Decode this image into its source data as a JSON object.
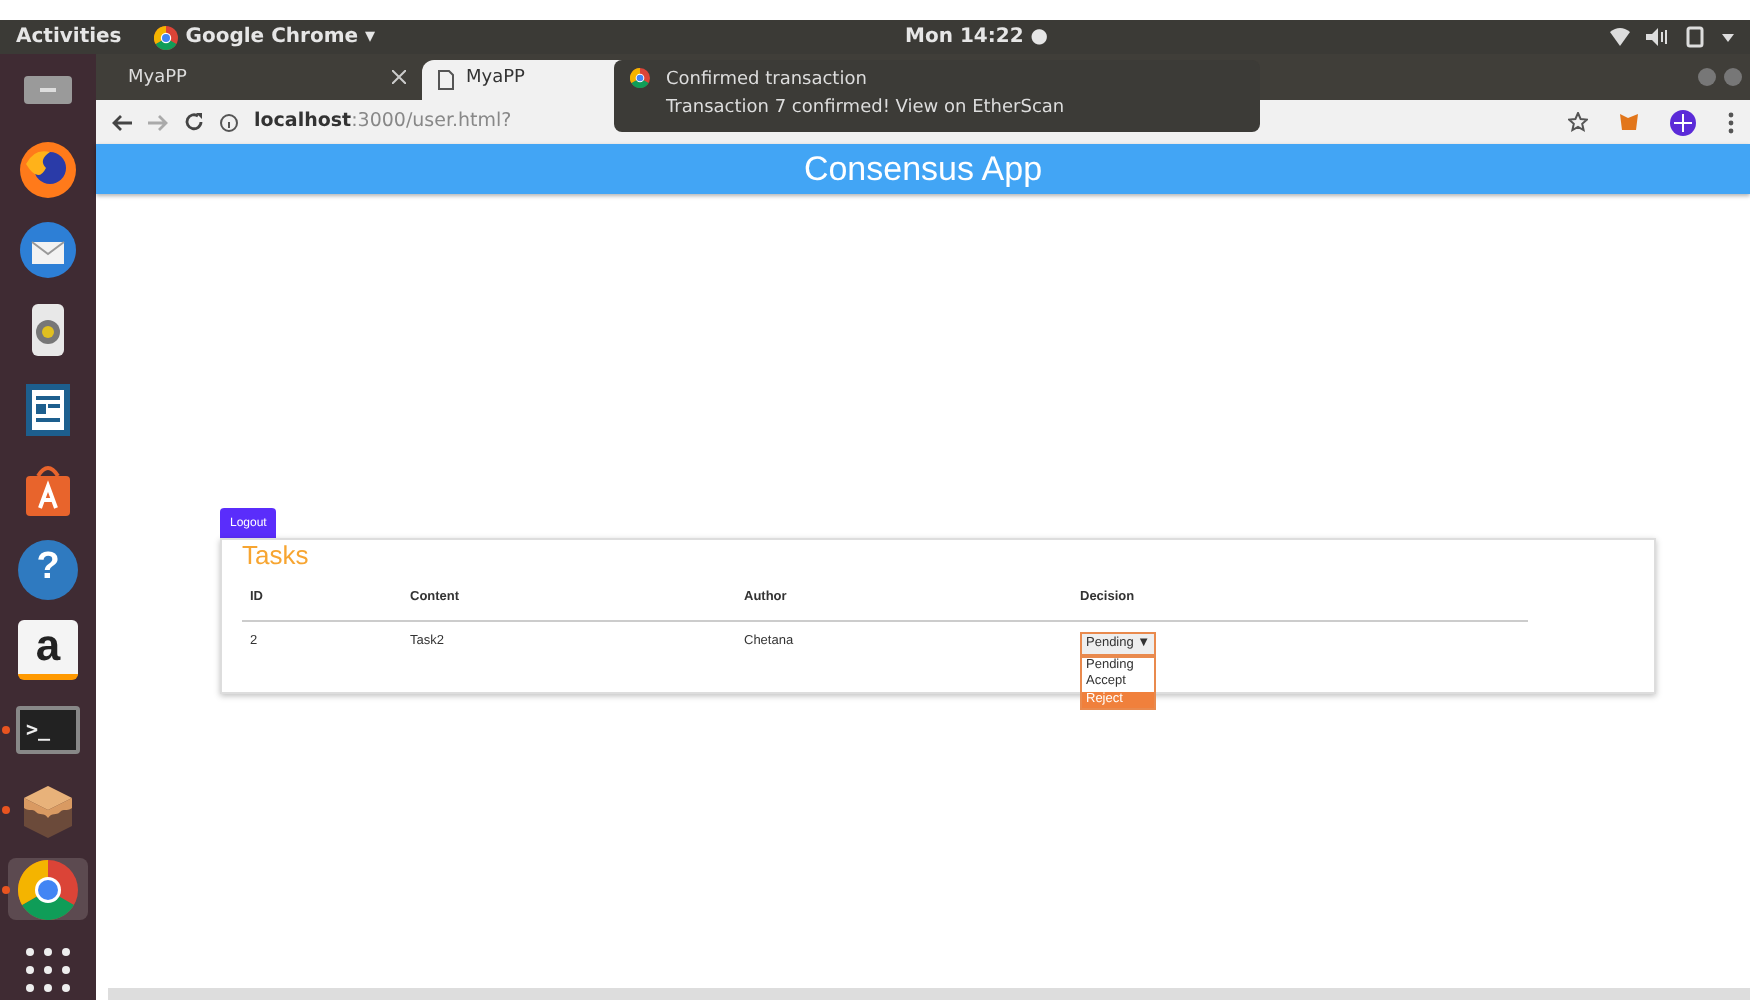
{
  "top_bar": {
    "activities": "Activities",
    "app_menu": "Google Chrome ▾",
    "clock": "Mon 14:22 ●"
  },
  "dock": [
    {
      "kind": "trash",
      "running": false,
      "selected": false
    },
    {
      "kind": "firefox",
      "running": false,
      "selected": false
    },
    {
      "kind": "mail",
      "running": false,
      "selected": false
    },
    {
      "kind": "speaker",
      "running": false,
      "selected": false
    },
    {
      "kind": "writer",
      "running": false,
      "selected": false
    },
    {
      "kind": "store",
      "running": false,
      "selected": false
    },
    {
      "kind": "help",
      "glyph": "?",
      "running": false,
      "selected": false
    },
    {
      "kind": "amazon",
      "glyph": "a",
      "running": false,
      "selected": false
    },
    {
      "kind": "terminal",
      "glyph": ">_",
      "running": true,
      "selected": false
    },
    {
      "kind": "box",
      "running": true,
      "selected": false
    },
    {
      "kind": "chrome",
      "running": true,
      "selected": true
    },
    {
      "kind": "apps",
      "running": false,
      "selected": false
    }
  ],
  "tabs": [
    {
      "label": "MyaPP",
      "selected": false
    },
    {
      "label": "MyaPP",
      "selected": true
    }
  ],
  "address": "**localhost**:3000/user.html?",
  "notification": {
    "title": "Confirmed transaction",
    "body": "Transaction 7 confirmed! View on EtherScan"
  },
  "app_header": "Consensus App",
  "logout": "Logout",
  "tasks": {
    "title": "Tasks",
    "columns": [
      "ID",
      "Content",
      "Author",
      "Decision"
    ],
    "rows": [
      {
        "id": "2",
        "content": "Task2",
        "author": "Chetana",
        "decision": {
          "value": "Pending ▼",
          "options": [
            {
              "label": "Pending",
              "selected": false
            },
            {
              "label": "Accept",
              "selected": false
            },
            {
              "label": "Reject",
              "selected": true
            }
          ]
        }
      }
    ]
  }
}
